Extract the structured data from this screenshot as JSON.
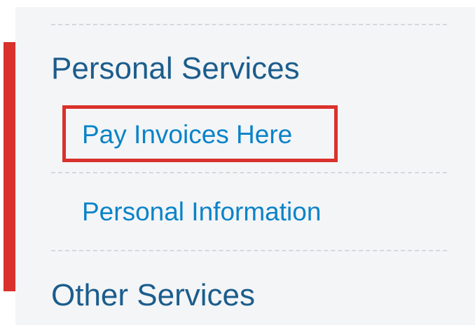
{
  "colors": {
    "accent": "#d9312b",
    "heading": "#1b5d8c",
    "link": "#0a83c8",
    "panel_bg": "#f4f5f7",
    "divider": "#d6d8dc"
  },
  "sidebar": {
    "sections": [
      {
        "heading": "Personal Services",
        "items": [
          {
            "label": "Pay Invoices Here",
            "highlighted": true
          },
          {
            "label": "Personal Information",
            "highlighted": false
          }
        ]
      },
      {
        "heading": "Other Services",
        "items": []
      }
    ]
  }
}
